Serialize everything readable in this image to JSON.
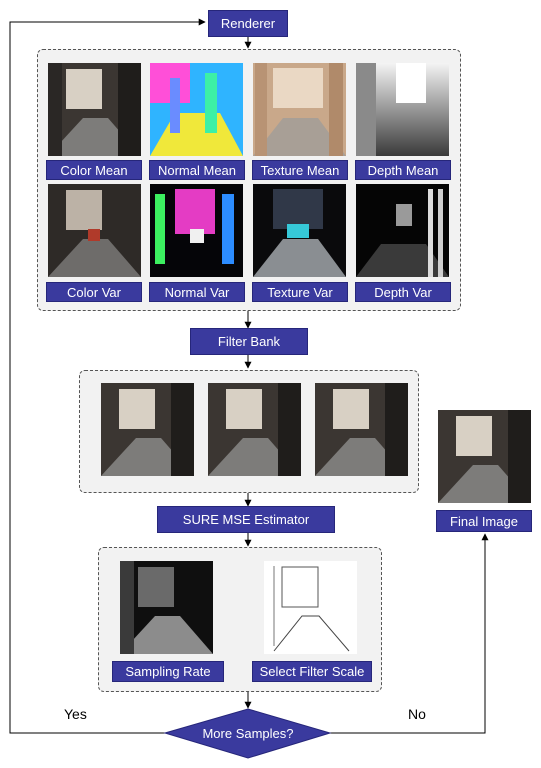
{
  "nodes": {
    "renderer": "Renderer",
    "filter_bank": "Filter Bank",
    "sure": "SURE MSE Estimator",
    "final": "Final Image",
    "decision": "More Samples?"
  },
  "features": [
    "Color Mean",
    "Normal Mean",
    "Texture Mean",
    "Depth Mean",
    "Color Var",
    "Normal Var",
    "Texture Var",
    "Depth Var"
  ],
  "bottom_labels": [
    "Sampling Rate",
    "Select Filter Scale"
  ],
  "branches": {
    "yes": "Yes",
    "no": "No"
  },
  "colors": {
    "node_fill": "#3a3a9e",
    "group_fill": "#f2f2f2",
    "arrow": "#000000"
  }
}
